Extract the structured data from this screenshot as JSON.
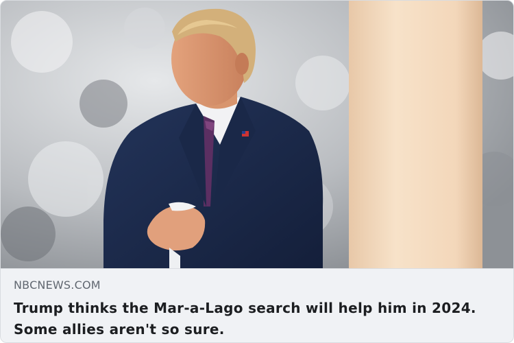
{
  "link_preview": {
    "image_alt": "",
    "domain": "NBCNEWS.COM",
    "headline": "Trump thinks the Mar-a-Lago search will help him in 2024. Some allies aren't so sure."
  },
  "colors": {
    "background": "#f0f2f5",
    "domain_text": "#606770",
    "headline_text": "#1c1e21",
    "suit": "#1c2b4d",
    "pillar": "#f3d9bd"
  }
}
